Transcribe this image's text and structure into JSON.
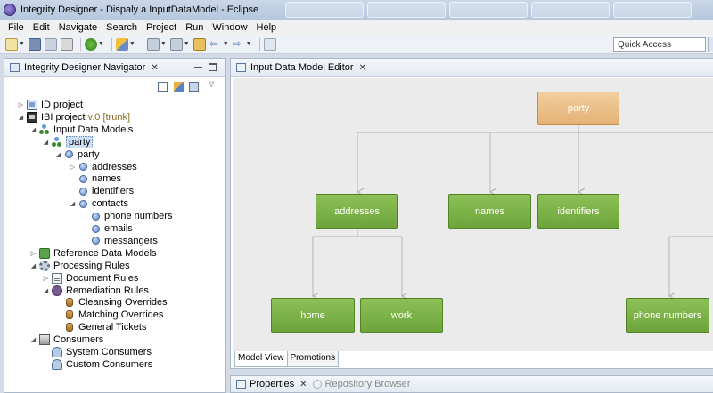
{
  "window": {
    "title": "Integrity Designer - Dispaly a InputDataModel - Eclipse"
  },
  "menu": [
    "File",
    "Edit",
    "Navigate",
    "Search",
    "Project",
    "Run",
    "Window",
    "Help"
  ],
  "toolbar": {
    "quick_access_placeholder": "Quick Access"
  },
  "navigator": {
    "title": "Integrity Designer Navigator",
    "tree": [
      {
        "id": "id-project",
        "label": "ID project",
        "level": 0,
        "toggle": "collapsed",
        "icon": "project-icon"
      },
      {
        "id": "ibi-project",
        "label": "IBI project",
        "version": "v.0 [trunk]",
        "level": 0,
        "toggle": "expanded",
        "icon": "project-icon"
      },
      {
        "id": "input-data-models",
        "label": "Input Data Models",
        "level": 1,
        "toggle": "expanded",
        "icon": "models-icon"
      },
      {
        "id": "party-model",
        "label": "party",
        "level": 2,
        "toggle": "expanded",
        "icon": "models-icon",
        "selected": true
      },
      {
        "id": "party",
        "label": "party",
        "level": 3,
        "toggle": "expanded",
        "icon": "entity-icon"
      },
      {
        "id": "addresses",
        "label": "addresses",
        "level": 4,
        "toggle": "collapsed",
        "icon": "entity-icon"
      },
      {
        "id": "names",
        "label": "names",
        "level": 4,
        "toggle": "none",
        "icon": "entity-icon"
      },
      {
        "id": "identifiers",
        "label": "identifiers",
        "level": 4,
        "toggle": "none",
        "icon": "entity-icon"
      },
      {
        "id": "contacts",
        "label": "contacts",
        "level": 4,
        "toggle": "expanded",
        "icon": "entity-icon"
      },
      {
        "id": "phone-numbers",
        "label": "phone numbers",
        "level": 5,
        "toggle": "none",
        "icon": "entity-icon"
      },
      {
        "id": "emails",
        "label": "emails",
        "level": 5,
        "toggle": "none",
        "icon": "entity-icon"
      },
      {
        "id": "messangers",
        "label": "messangers",
        "level": 5,
        "toggle": "none",
        "icon": "entity-icon"
      },
      {
        "id": "reference-data-models",
        "label": "Reference Data Models",
        "level": 1,
        "toggle": "collapsed",
        "icon": "reference-icon"
      },
      {
        "id": "processing-rules",
        "label": "Processing Rules",
        "level": 1,
        "toggle": "expanded",
        "icon": "gear-icon"
      },
      {
        "id": "document-rules",
        "label": "Document Rules",
        "level": 2,
        "toggle": "collapsed",
        "icon": "document-icon"
      },
      {
        "id": "remediation-rules",
        "label": "Remediation Rules",
        "level": 2,
        "toggle": "expanded",
        "icon": "remediation-icon"
      },
      {
        "id": "cleansing-overrides",
        "label": "Cleansing Overrides",
        "level": 3,
        "toggle": "none",
        "icon": "database-icon"
      },
      {
        "id": "matching-overrides",
        "label": "Matching Overrides",
        "level": 3,
        "toggle": "none",
        "icon": "database-icon"
      },
      {
        "id": "general-tickets",
        "label": "General Tickets",
        "level": 3,
        "toggle": "none",
        "icon": "database-icon"
      },
      {
        "id": "consumers",
        "label": "Consumers",
        "level": 1,
        "toggle": "expanded",
        "icon": "consumers-icon"
      },
      {
        "id": "system-consumers",
        "label": "System Consumers",
        "level": 2,
        "toggle": "none",
        "icon": "user-icon"
      },
      {
        "id": "custom-consumers",
        "label": "Custom Consumers",
        "level": 2,
        "toggle": "none",
        "icon": "user-icon"
      }
    ]
  },
  "editor": {
    "title": "Input Data Model Editor",
    "nodes": {
      "party": "party",
      "addresses": "addresses",
      "names": "names",
      "identifiers": "identifiers",
      "home": "home",
      "work": "work",
      "phone_numbers": "phone numbers"
    },
    "tabs": [
      "Model View",
      "Promotions"
    ],
    "colors": {
      "root_node": "#e8ba7f",
      "child_node": "#7db14a",
      "canvas": "#ebebeb",
      "connector": "#b5b5b5"
    }
  },
  "bottom_panel": {
    "tabs": [
      "Properties",
      "Repository Browser"
    ]
  }
}
